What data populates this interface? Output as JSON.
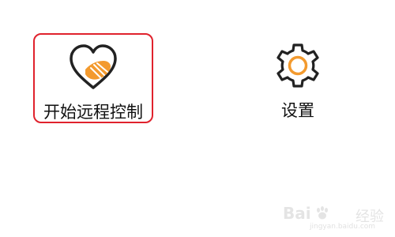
{
  "tiles": [
    {
      "label": "开始远程控制",
      "icon": "heart-handshake-icon",
      "selected": true
    },
    {
      "label": "设置",
      "icon": "gear-icon",
      "selected": false
    }
  ],
  "colors": {
    "accent": "#f39a2e",
    "icon_stroke": "#222222",
    "selection_border": "#e0222d",
    "background": "#ffffff"
  },
  "watermark": {
    "brand_left": "Bai",
    "brand_right": "经验",
    "url": "jingyan.baidu.com"
  }
}
